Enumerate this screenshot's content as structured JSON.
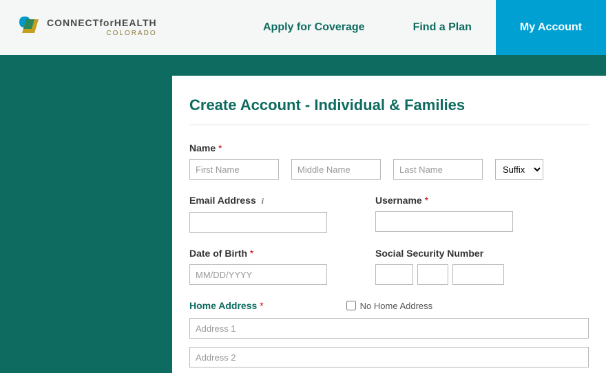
{
  "logo": {
    "connect": "CONNECT",
    "for": "for",
    "health": "HEALTH",
    "sub": "COLORADO"
  },
  "nav": {
    "apply": "Apply for Coverage",
    "find": "Find a Plan",
    "account": "My Account"
  },
  "page": {
    "title": "Create Account - Individual & Families"
  },
  "form": {
    "name_label": "Name",
    "first_ph": "First Name",
    "middle_ph": "Middle Name",
    "last_ph": "Last Name",
    "suffix_label": "Suffix",
    "email_label": "Email Address",
    "username_label": "Username",
    "dob_label": "Date of Birth",
    "dob_ph": "MM/DD/YYYY",
    "ssn_label": "Social Security Number",
    "home_addr_label": "Home Address",
    "no_home_label": "No Home Address",
    "addr1_ph": "Address 1",
    "addr2_ph": "Address 2"
  }
}
